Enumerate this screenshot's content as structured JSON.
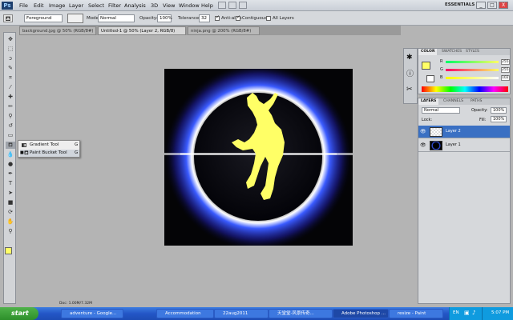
{
  "app": {
    "logo_text": "Ps",
    "menus": [
      "File",
      "Edit",
      "Image",
      "Layer",
      "Select",
      "Filter",
      "Analysis",
      "3D",
      "View",
      "Window",
      "Help"
    ],
    "workspace": "ESSENTIALS",
    "win_controls": [
      "_",
      "□",
      "X"
    ]
  },
  "options": {
    "fill_source": "Foreground",
    "mode_label": "Mode:",
    "mode_value": "Normal",
    "opacity_label": "Opacity:",
    "opacity_value": "100%",
    "tolerance_label": "Tolerance:",
    "tolerance_value": "32",
    "antialias_label": "Anti-alias",
    "contiguous_label": "Contiguous",
    "alllayers_label": "All Layers"
  },
  "tabs": [
    {
      "label": "background.jpg @ 50% (RGB/8#)",
      "active": false
    },
    {
      "label": "Untitled-1 @ 50% (Layer 2, RGB/8)",
      "active": true
    },
    {
      "label": "ninja.png @ 200% (RGB/8#)",
      "active": false
    }
  ],
  "flyout": {
    "items": [
      {
        "label": "Gradient Tool",
        "key": "G"
      },
      {
        "label": "Paint Bucket Tool",
        "key": "G"
      }
    ]
  },
  "color_panel": {
    "tabs": [
      "COLOR",
      "SWATCHES",
      "STYLES"
    ],
    "channels": [
      {
        "label": "R",
        "value": "255"
      },
      {
        "label": "G",
        "value": "255"
      },
      {
        "label": "B",
        "value": "102"
      }
    ],
    "foreground": "#ffff66"
  },
  "layers_panel": {
    "tabs": [
      "LAYERS",
      "CHANNELS",
      "PATHS"
    ],
    "blend_mode": "Normal",
    "opacity_label": "Opacity:",
    "opacity_value": "100%",
    "lock_label": "Lock:",
    "fill_label": "Fill:",
    "fill_value": "100%",
    "layers": [
      {
        "name": "Layer 2",
        "selected": true
      },
      {
        "name": "Layer 1",
        "selected": false
      }
    ]
  },
  "status": {
    "doc": "Doc: 1.00M/7.32M"
  },
  "taskbar": {
    "start_label": "start",
    "buttons": [
      {
        "label": "adventure - Google..."
      },
      {
        "label": "Accommodation"
      },
      {
        "label": "22aug2011"
      },
      {
        "label": "天堂堂-风景传奇..."
      },
      {
        "label": "Adobe Photoshop ..."
      },
      {
        "label": "resize - Paint"
      }
    ],
    "lang": "EN",
    "time": "5:07 PM"
  }
}
